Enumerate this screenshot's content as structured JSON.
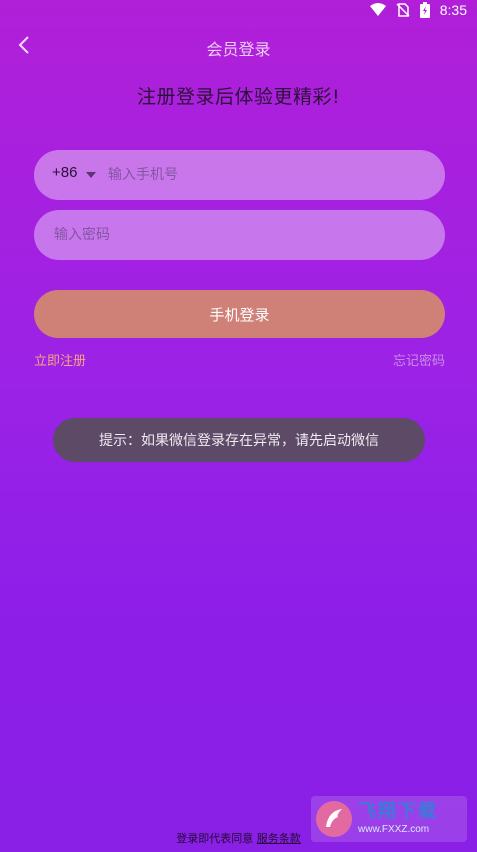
{
  "statusbar": {
    "time": "8:35"
  },
  "header": {
    "title": "会员登录"
  },
  "headline": "注册登录后体验更精彩!",
  "phone": {
    "country_code": "+86",
    "placeholder": "输入手机号"
  },
  "password": {
    "placeholder": "输入密码"
  },
  "login_label": "手机登录",
  "links": {
    "register": "立即注册",
    "forgot": "忘记密码"
  },
  "toast": "提示：如果微信登录存在异常，请先启动微信",
  "footer": {
    "prefix": "登录即代表同意",
    "terms": "服务条款"
  },
  "watermark": {
    "title": "飞翔下载",
    "url": "www.FXXZ.com"
  },
  "colors": {
    "accent": "#cf8178",
    "link": "#f4a57f"
  },
  "icons": {
    "back": "chevron-left-icon",
    "dropdown": "caret-down-icon"
  }
}
